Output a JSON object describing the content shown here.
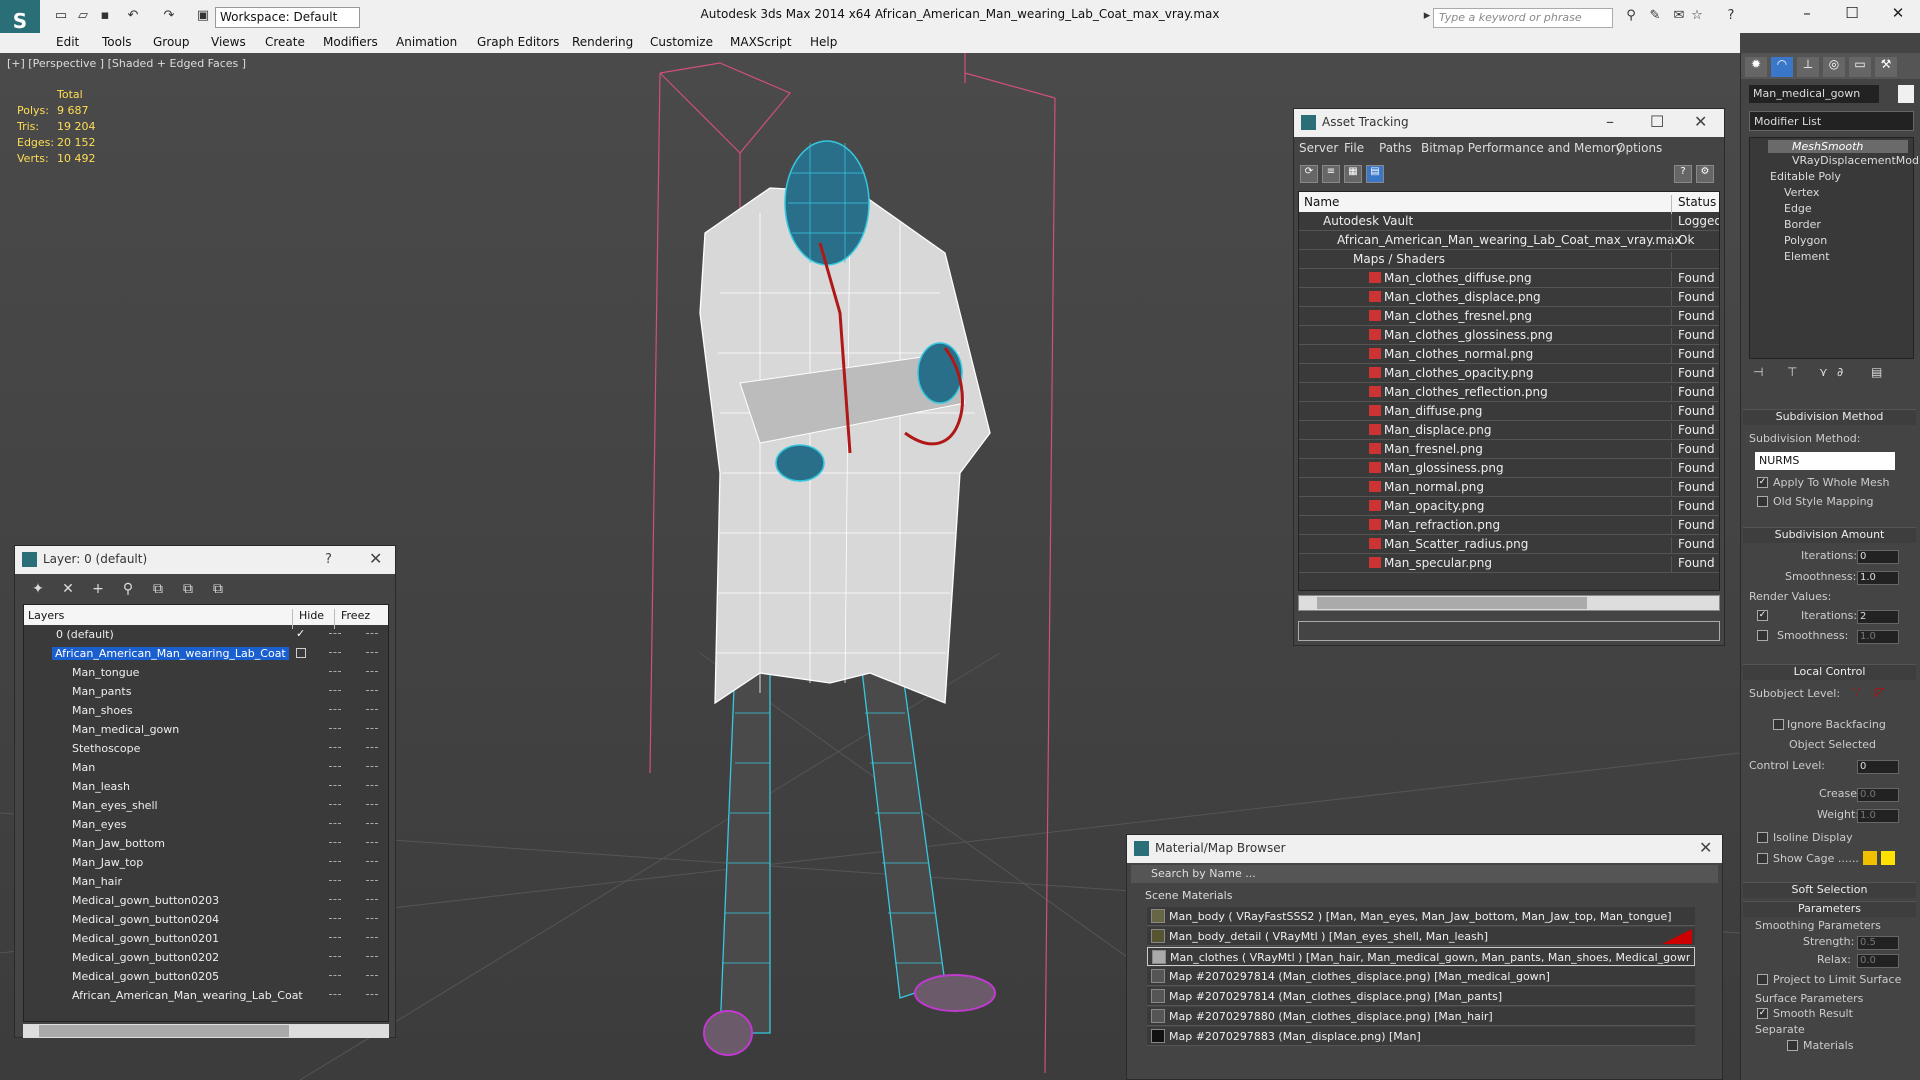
{
  "titlebar": {
    "workspace": "Workspace: Default",
    "title": "Autodesk 3ds Max  2014 x64      African_American_Man_wearing_Lab_Coat_max_vray.max",
    "search_placeholder": "Type a keyword or phrase"
  },
  "menubar": [
    "Edit",
    "Tools",
    "Group",
    "Views",
    "Create",
    "Modifiers",
    "Animation",
    "Graph Editors",
    "Rendering",
    "Customize",
    "MAXScript",
    "Help"
  ],
  "viewport": {
    "label": "[+] [Perspective ] [Shaded + Edged Faces ]",
    "stats": {
      "header": "Total",
      "polys_label": "Polys:",
      "polys": "9 687",
      "tris_label": "Tris:",
      "tris": "19 204",
      "edges_label": "Edges:",
      "edges": "20 152",
      "verts_label": "Verts:",
      "verts": "10 492"
    }
  },
  "asset_tracking": {
    "title": "Asset Tracking",
    "menu": [
      "Server",
      "File",
      "Paths",
      "Bitmap Performance and Memory",
      "Options"
    ],
    "col_name": "Name",
    "col_status": "Status",
    "rows": [
      {
        "name": "Autodesk Vault",
        "status": "Logged O"
      },
      {
        "name": "African_American_Man_wearing_Lab_Coat_max_vray.max",
        "status": "Ok"
      },
      {
        "name": "Maps / Shaders",
        "status": ""
      },
      {
        "name": "Man_clothes_diffuse.png",
        "status": "Found"
      },
      {
        "name": "Man_clothes_displace.png",
        "status": "Found"
      },
      {
        "name": "Man_clothes_fresnel.png",
        "status": "Found"
      },
      {
        "name": "Man_clothes_glossiness.png",
        "status": "Found"
      },
      {
        "name": "Man_clothes_normal.png",
        "status": "Found"
      },
      {
        "name": "Man_clothes_opacity.png",
        "status": "Found"
      },
      {
        "name": "Man_clothes_reflection.png",
        "status": "Found"
      },
      {
        "name": "Man_diffuse.png",
        "status": "Found"
      },
      {
        "name": "Man_displace.png",
        "status": "Found"
      },
      {
        "name": "Man_fresnel.png",
        "status": "Found"
      },
      {
        "name": "Man_glossiness.png",
        "status": "Found"
      },
      {
        "name": "Man_normal.png",
        "status": "Found"
      },
      {
        "name": "Man_opacity.png",
        "status": "Found"
      },
      {
        "name": "Man_refraction.png",
        "status": "Found"
      },
      {
        "name": "Man_Scatter_radius.png",
        "status": "Found"
      },
      {
        "name": "Man_specular.png",
        "status": "Found"
      }
    ]
  },
  "layer_panel": {
    "title": "Layer: 0 (default)",
    "help": "?",
    "col_layers": "Layers",
    "col_hide": "Hide",
    "col_freeze": "Freez",
    "rows": [
      "0 (default)",
      "African_American_Man_wearing_Lab_Coat",
      "Man_tongue",
      "Man_pants",
      "Man_shoes",
      "Man_medical_gown",
      "Stethoscope",
      "Man",
      "Man_leash",
      "Man_eyes_shell",
      "Man_eyes",
      "Man_Jaw_bottom",
      "Man_Jaw_top",
      "Man_hair",
      "Medical_gown_button0203",
      "Medical_gown_button0204",
      "Medical_gown_button0201",
      "Medical_gown_button0202",
      "Medical_gown_button0205",
      "African_American_Man_wearing_Lab_Coat"
    ]
  },
  "material_browser": {
    "title": "Material/Map Browser",
    "search": "Search by Name ...",
    "section": "Scene Materials",
    "rows": [
      "Man_body  ( VRayFastSSS2 )  [Man, Man_eyes, Man_Jaw_bottom, Man_Jaw_top, Man_tongue]",
      "Man_body_detail  ( VRayMtl )  [Man_eyes_shell, Man_leash]",
      "Man_clothes  ( VRayMtl )  [Man_hair, Man_medical_gown, Man_pants, Man_shoes, Medical_gown_butto...",
      "Map #2070297814 (Man_clothes_displace.png)  [Man_medical_gown]",
      "Map #2070297814 (Man_clothes_displace.png)  [Man_pants]",
      "Map #2070297880 (Man_clothes_displace.png)  [Man_hair]",
      "Map #2070297883 (Man_displace.png)  [Man]"
    ]
  },
  "command_panel": {
    "object_name": "Man_medical_gown",
    "modifier_list": "Modifier List",
    "stack": [
      "MeshSmooth",
      "VRayDisplacementMod",
      "Editable Poly",
      "Vertex",
      "Edge",
      "Border",
      "Polygon",
      "Element"
    ],
    "subdiv_method_header": "Subdivision Method",
    "subdiv_method_label": "Subdivision Method:",
    "subdiv_method_value": "NURMS",
    "apply_whole_mesh": "Apply To Whole Mesh",
    "old_style": "Old Style Mapping",
    "subdiv_amount_header": "Subdivision Amount",
    "iterations_label": "Iterations:",
    "iterations": "0",
    "smoothness_label": "Smoothness:",
    "smoothness": "1.0",
    "render_values": "Render Values:",
    "r_iterations_label": "Iterations:",
    "r_iterations": "2",
    "r_smoothness_label": "Smoothness:",
    "r_smoothness": "1.0",
    "local_control_header": "Local Control",
    "subobject_level": "Subobject Level:",
    "ignore_backfacing": "Ignore Backfacing",
    "object_selected": "Object Selected",
    "control_level_label": "Control Level:",
    "control_level": "0",
    "crease_label": "Crease:",
    "crease": "0.0",
    "weight_label": "Weight:",
    "weight": "1.0",
    "isoline": "Isoline Display",
    "show_cage": "Show Cage ......",
    "soft_selection": "Soft Selection",
    "parameters": "Parameters",
    "smoothing_params": "Smoothing Parameters",
    "strength_label": "Strength:",
    "strength": "0.5",
    "relax_label": "Relax:",
    "relax": "0.0",
    "project_limit": "Project to Limit Surface",
    "surface_params": "Surface Parameters",
    "smooth_result": "Smooth Result",
    "separate": "Separate",
    "materials": "Materials"
  },
  "colors": {
    "accent": "#2a6f77",
    "selection": "#1a5fd0",
    "stats": "#ffdd55",
    "wire_cyan": "#35c8e0",
    "wire_white": "#ffffff",
    "bbox_pink": "#d0507a",
    "stethoscope": "#b01818",
    "shoes": "#c03ad0"
  }
}
